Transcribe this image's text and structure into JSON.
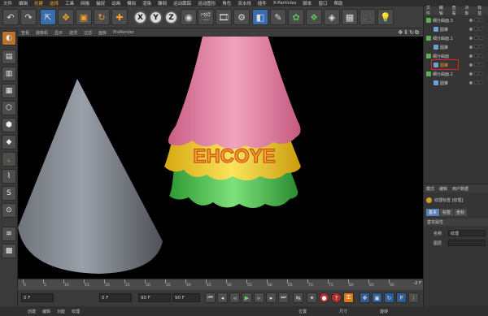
{
  "menubar": [
    "文件",
    "编辑",
    "创建",
    "选择",
    "工具",
    "网格",
    "捕捉",
    "动画",
    "模拟",
    "渲染",
    "雕刻",
    "运动跟踪",
    "运动图形",
    "角色",
    "流水线",
    "插件",
    "X-Particles",
    "脚本",
    "窗口",
    "帮助"
  ],
  "menubar_highlight": [
    2,
    3
  ],
  "toolbar": {
    "undo_icon": "undo-arrow",
    "axis_x": "X",
    "axis_y": "Y",
    "axis_z": "Z",
    "coord_icon": "world-coords"
  },
  "viewport": {
    "tabs": [
      "查看",
      "摄像机",
      "显示",
      "选项",
      "过滤",
      "面板",
      "ProRender"
    ],
    "controls": "✥⇕↻⧉",
    "overlay_text": "EHCOYE",
    "colors": {
      "pink": "#e38aa8",
      "yellow": "#f0d21c",
      "green": "#4fc24f",
      "cone": "#8a8f97",
      "accent": "#f3a126"
    }
  },
  "timeline": {
    "ticks": [
      "0",
      "5",
      "10",
      "15",
      "20",
      "25",
      "30",
      "35",
      "40",
      "45",
      "50",
      "55",
      "60",
      "65",
      "70",
      "75",
      "80",
      "85",
      "90"
    ],
    "current_frame": "-2 F"
  },
  "transport": {
    "start_field": "0 F",
    "current_field": "0 F",
    "end_field": "90 F",
    "end_field2": "90 F"
  },
  "bottom_tabs": [
    "创建",
    "编辑",
    "功能",
    "纹理"
  ],
  "bottom_labels": {
    "position": "位置",
    "size": "尺寸",
    "rotation": "旋转"
  },
  "object_manager": {
    "tabs": [
      "文件",
      "编辑",
      "查看",
      "对象",
      "标签"
    ],
    "rows": [
      {
        "label": "细分曲面.3",
        "indent": 0,
        "icon": "subdivision-icon",
        "selected": false
      },
      {
        "label": "圆锥",
        "indent": 1,
        "icon": "cone-icon",
        "selected": false
      },
      {
        "label": "细分曲面.1",
        "indent": 0,
        "icon": "subdivision-icon",
        "selected": false
      },
      {
        "label": "圆锥",
        "indent": 1,
        "icon": "cone-icon",
        "selected": false
      },
      {
        "label": "细分曲面",
        "indent": 0,
        "icon": "subdivision-icon",
        "selected": false
      },
      {
        "label": "圆锥",
        "indent": 1,
        "icon": "cone-icon",
        "selected": true
      },
      {
        "label": "细分曲面.2",
        "indent": 0,
        "icon": "subdivision-icon",
        "selected": false
      },
      {
        "label": "圆锥",
        "indent": 1,
        "icon": "cone-icon",
        "selected": false
      }
    ]
  },
  "attribute_manager": {
    "tabs": [
      "模式",
      "编辑",
      "用户数据"
    ],
    "title": "纹理标签 [纹理]",
    "subtabs": [
      "基本",
      "标签",
      "坐标"
    ],
    "section": "基本属性",
    "name_label": "名称",
    "name_value": "纹理",
    "layer_label": "图层",
    "layer_value": ""
  }
}
